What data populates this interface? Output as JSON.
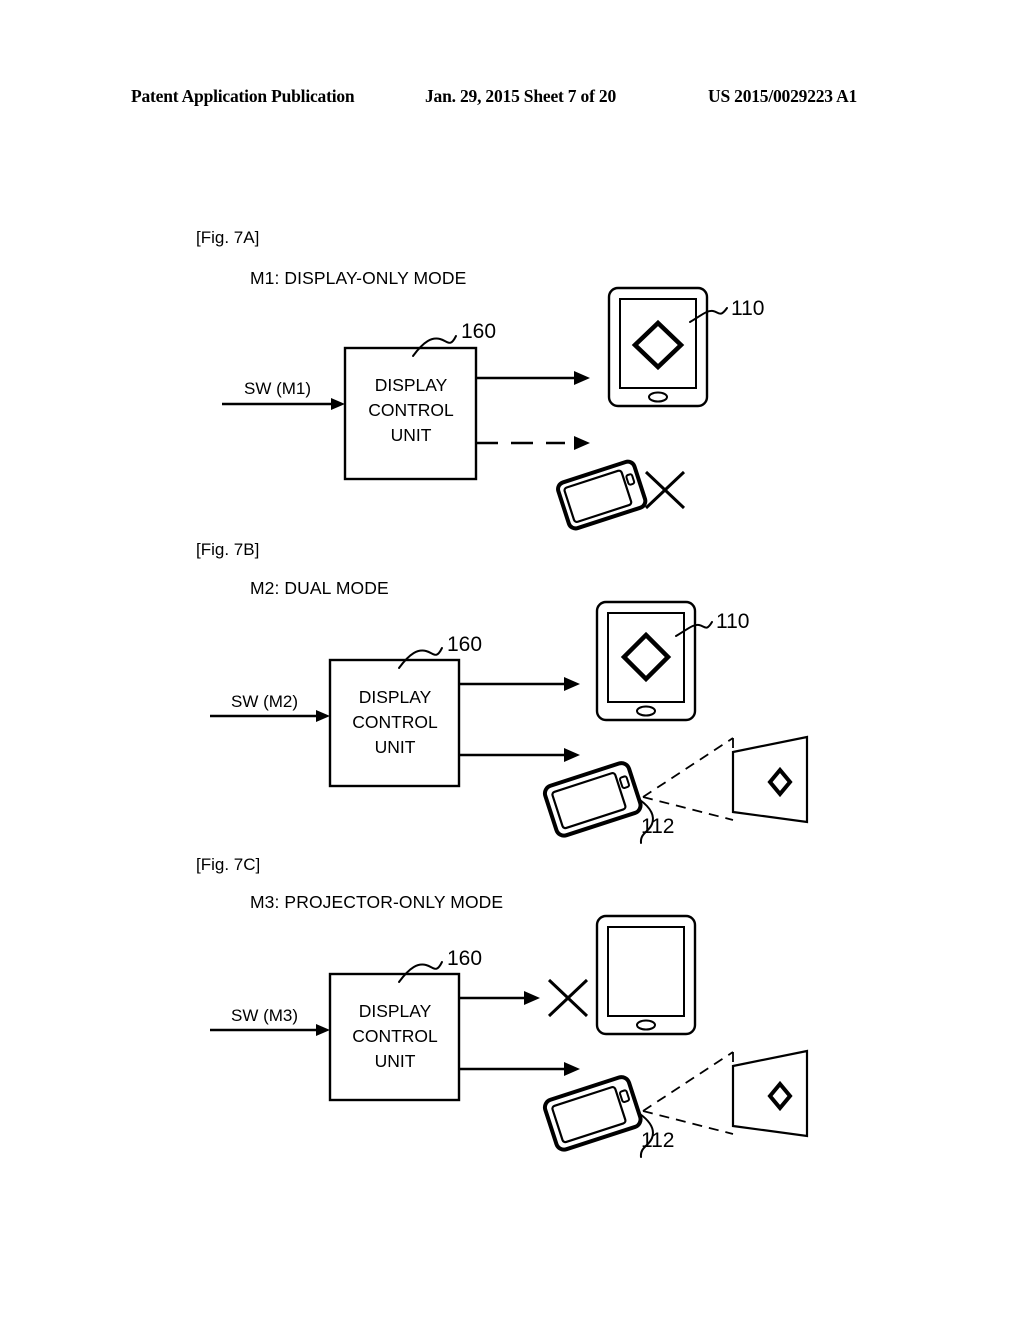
{
  "header": {
    "left": "Patent Application Publication",
    "middle": "Jan. 29, 2015  Sheet 7 of 20",
    "right": "US 2015/0029223 A1"
  },
  "figures": [
    {
      "tag": "[Fig. 7A]",
      "mode_title": "M1: DISPLAY-ONLY MODE",
      "block_label_line1": "DISPLAY",
      "block_label_line2": "CONTROL",
      "block_label_line3": "UNIT",
      "block_ref": "160",
      "input_label": "SW (M1)",
      "tablet_ref": "110",
      "projector_ref": "",
      "display_output": "enabled",
      "projector_output": "disabled"
    },
    {
      "tag": "[Fig. 7B]",
      "mode_title": "M2: DUAL MODE",
      "block_label_line1": "DISPLAY",
      "block_label_line2": "CONTROL",
      "block_label_line3": "UNIT",
      "block_ref": "160",
      "input_label": "SW (M2)",
      "tablet_ref": "110",
      "projector_ref": "112",
      "display_output": "enabled",
      "projector_output": "enabled"
    },
    {
      "tag": "[Fig. 7C]",
      "mode_title": "M3: PROJECTOR-ONLY MODE",
      "block_label_line1": "DISPLAY",
      "block_label_line2": "CONTROL",
      "block_label_line3": "UNIT",
      "block_ref": "160",
      "input_label": "SW (M3)",
      "tablet_ref": "",
      "projector_ref": "112",
      "display_output": "disabled",
      "projector_output": "enabled"
    }
  ],
  "colors": {
    "ink": "#000000",
    "paper": "#ffffff"
  }
}
